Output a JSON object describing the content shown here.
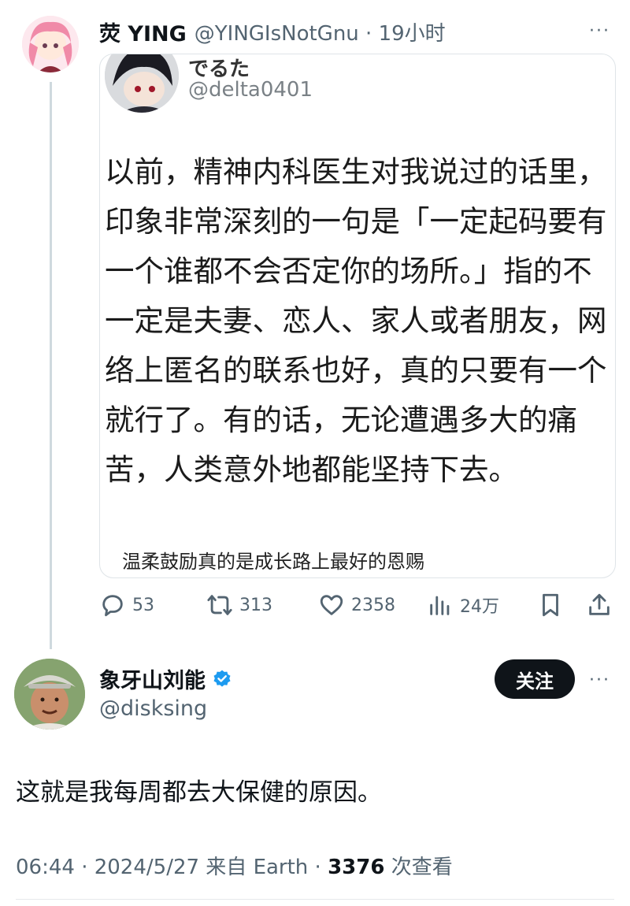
{
  "parent_tweet": {
    "display_name": "荧 YING",
    "handle_time": "@YINGIsNotGnu · 19小时",
    "more": "···",
    "embedded_screenshot": {
      "name": "でるた",
      "handle": "@delta0401",
      "text": "以前，精神内科医生对我说过的话里，印象非常深刻的一句是「一定起码要有一个谁都不会否定你的场所。」指的不一定是夫妻、恋人、家人或者朋友，网络上匿名的联系也好，真的只要有一个就行了。有的话，无论遭遇多大的痛苦，人类意外地都能坚持下去。",
      "caption": "温柔鼓励真的是成长路上最好的恩赐"
    },
    "actions": {
      "replies": "53",
      "retweets": "313",
      "likes": "2358",
      "views": "24万"
    }
  },
  "main_tweet": {
    "display_name": "象牙山刘能",
    "handle": "@disksing",
    "follow_label": "关注",
    "more": "···",
    "text": "这就是我每周都去大保健的原因。",
    "meta_prefix": "06:44 · 2024/5/27 来自 Earth · ",
    "view_count": "3376",
    "view_suffix": " 次查看"
  },
  "colors": {
    "text": "#0f1419",
    "secondary": "#536471",
    "verified": "#1d9bf0",
    "follow_bg": "#0f1419"
  },
  "icons": [
    "reply-icon",
    "retweet-icon",
    "like-icon",
    "views-icon",
    "bookmark-icon",
    "share-icon",
    "verified-icon",
    "more-icon"
  ]
}
